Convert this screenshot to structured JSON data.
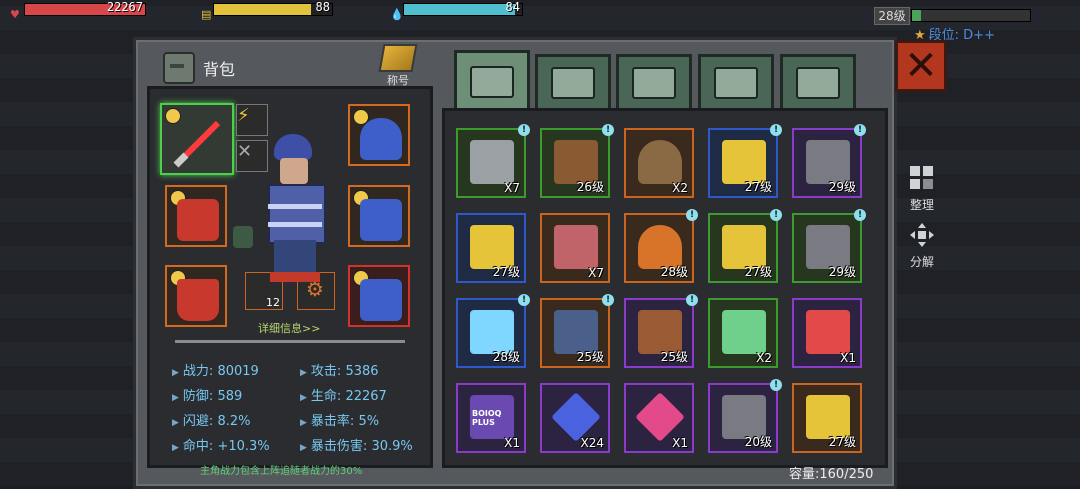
{
  "hud": {
    "hp_value": "22267",
    "energy_value": "88",
    "water_value": "84",
    "level_label": "28级",
    "rank_label": "段位: D++",
    "hp_color": "#d7474a",
    "energy_color": "#e3c23c",
    "water_color": "#4fbfd0"
  },
  "bag": {
    "title": "背包",
    "title_badge": "称号",
    "detail_link": "详细信息>>",
    "note": "主角战力包含上阵追随者战力的30%",
    "capacity": "容量:160/250",
    "small_slot_1": "12"
  },
  "stats": [
    {
      "label": "战力: ",
      "value": "80019"
    },
    {
      "label": "攻击: ",
      "value": "5386"
    },
    {
      "label": "防御: ",
      "value": "589"
    },
    {
      "label": "生命: ",
      "value": "22267"
    },
    {
      "label": "闪避: ",
      "value": "8.2%"
    },
    {
      "label": "暴击率: ",
      "value": "5%"
    },
    {
      "label": "命中: ",
      "value": "+10.3%"
    },
    {
      "label": "暴击伤害: ",
      "value": "30.9%"
    }
  ],
  "side": {
    "sort_label": "整理",
    "disassemble_label": "分解"
  },
  "tabs": [
    "backpack-icon",
    "medkit-icon",
    "food-icon",
    "gun-icon",
    "parts-icon"
  ],
  "inventory": [
    {
      "name": "tools",
      "rarity": "green",
      "count": "X7",
      "new": true,
      "color": "#9aa0a4"
    },
    {
      "name": "rifle",
      "rarity": "green",
      "count": "26级",
      "new": true,
      "color": "#8a5a33"
    },
    {
      "name": "mushroom",
      "rarity": "orange",
      "count": "X2",
      "new": false,
      "color": "#8a6a44"
    },
    {
      "name": "plasma-gun",
      "rarity": "blue",
      "count": "27级",
      "new": true,
      "color": "#e6c43a"
    },
    {
      "name": "crossbow",
      "rarity": "purple",
      "count": "29级",
      "new": true,
      "color": "#7a7a82"
    },
    {
      "name": "plasma-gun",
      "rarity": "blue",
      "count": "27级",
      "new": false,
      "color": "#e6c43a"
    },
    {
      "name": "meat",
      "rarity": "orange",
      "count": "X7",
      "new": false,
      "color": "#c0646a"
    },
    {
      "name": "helmet",
      "rarity": "orange",
      "count": "28级",
      "new": true,
      "color": "#d8742a"
    },
    {
      "name": "plasma-gun",
      "rarity": "green",
      "count": "27级",
      "new": true,
      "color": "#e6c43a"
    },
    {
      "name": "crossbow",
      "rarity": "green",
      "count": "29级",
      "new": true,
      "color": "#7a7a82"
    },
    {
      "name": "energy-blade",
      "rarity": "blue",
      "count": "28级",
      "new": true,
      "color": "#7fd6ff"
    },
    {
      "name": "pants",
      "rarity": "orange",
      "count": "25级",
      "new": true,
      "color": "#4a5f8a"
    },
    {
      "name": "boots",
      "rarity": "purple",
      "count": "25级",
      "new": true,
      "color": "#9a5a33"
    },
    {
      "name": "green-device",
      "rarity": "green",
      "count": "X2",
      "new": false,
      "color": "#6ed08a"
    },
    {
      "name": "red-device",
      "rarity": "purple",
      "count": "X1",
      "new": false,
      "color": "#e24a4a"
    },
    {
      "name": "plus-box",
      "rarity": "purple",
      "count": "X1",
      "new": false,
      "color": "#6a4ab0",
      "label": "BOIOQ PLUS"
    },
    {
      "name": "blue-crystal",
      "rarity": "purple",
      "count": "X24",
      "new": false,
      "color": "#4a62e0"
    },
    {
      "name": "pink-crystal",
      "rarity": "purple",
      "count": "X1",
      "new": false,
      "color": "#e24a8a"
    },
    {
      "name": "crossbow",
      "rarity": "purple",
      "count": "20级",
      "new": true,
      "color": "#7a7a82"
    },
    {
      "name": "plasma-gun",
      "rarity": "orange",
      "count": "27级",
      "new": false,
      "color": "#e6c43a"
    }
  ]
}
